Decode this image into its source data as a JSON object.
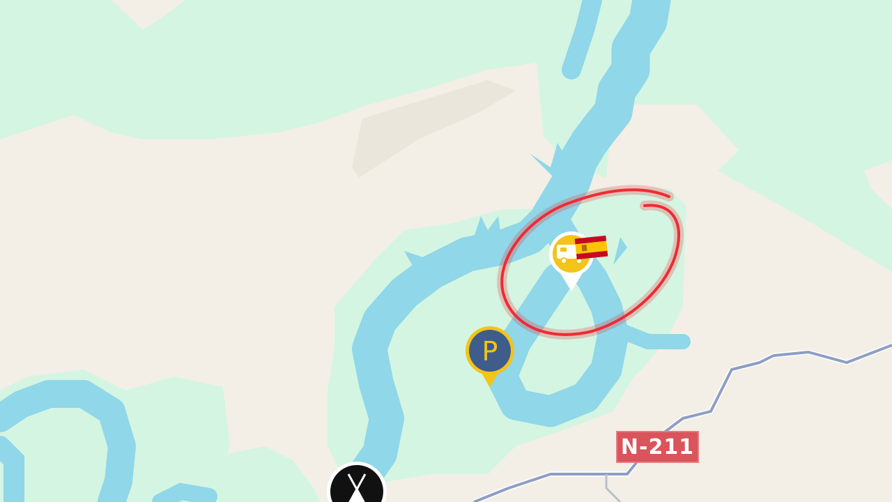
{
  "map": {
    "road_label": "N-211",
    "colors": {
      "land": "#f3efe6",
      "forest": "#d4f5e2",
      "water": "#8fd7e9",
      "road": "#8d9ec4",
      "road_label_bg": "#d9545b",
      "highlight_circle": "#ee2b33"
    },
    "markers": [
      {
        "name": "camper-marker",
        "icon": "camper-van-icon",
        "label": "",
        "color": "#f3c419"
      },
      {
        "name": "parking-marker",
        "icon": "parking-icon",
        "label": "P",
        "color": "#3e5c8c"
      },
      {
        "name": "campsite-marker",
        "icon": "tent-icon",
        "label": "",
        "color": "#111111"
      }
    ],
    "flag": "spain-flag-icon"
  }
}
